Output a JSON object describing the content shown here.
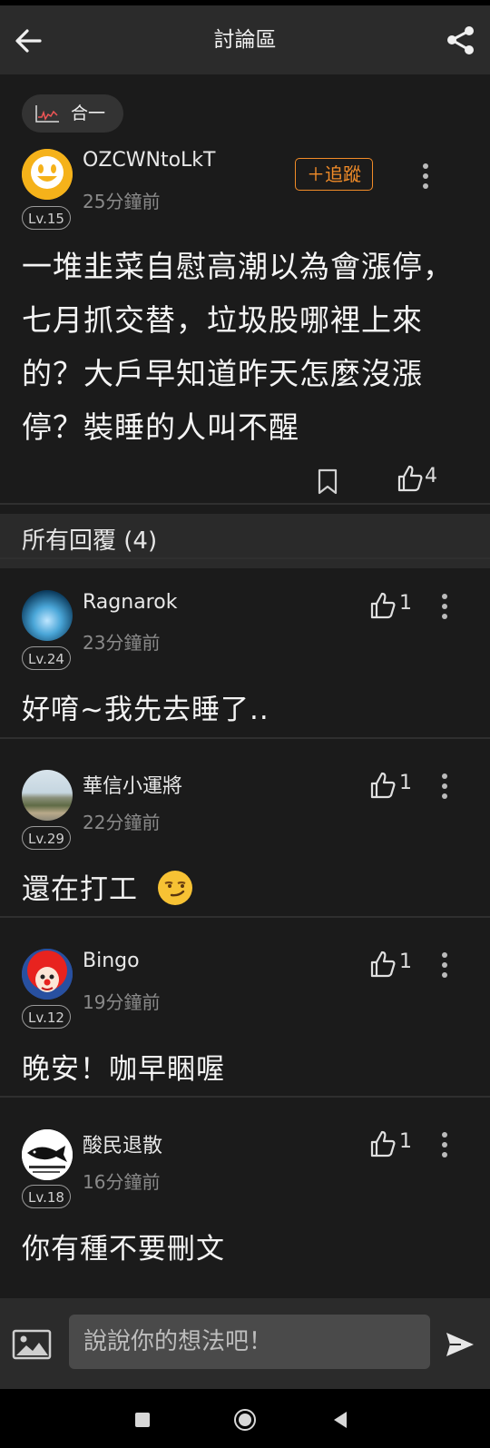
{
  "app": {
    "title": "討論區"
  },
  "post": {
    "tag": "合一",
    "author": "OZCWNtoLkT",
    "level": "Lv.15",
    "time": "25分鐘前",
    "follow_label": "＋追蹤",
    "text": "一堆韭菜自慰高潮以為會漲停，七月抓交替，垃圾股哪裡上來的？大戶早知道昨天怎麼沒漲停？裝睡的人叫不醒",
    "likes": "4"
  },
  "replies_header": "所有回覆 (4)",
  "replies": [
    {
      "user": "Ragnarok",
      "level": "Lv.24",
      "time": "23分鐘前",
      "likes": "1",
      "text": "好唷~我先去睡了.."
    },
    {
      "user": "華信小運將",
      "level": "Lv.29",
      "time": "22分鐘前",
      "likes": "1",
      "text": "還在打工"
    },
    {
      "user": "Bingo",
      "level": "Lv.12",
      "time": "19分鐘前",
      "likes": "1",
      "text": "晚安！咖早睏喔"
    },
    {
      "user": "酸民退散",
      "level": "Lv.18",
      "time": "16分鐘前",
      "likes": "1",
      "text": "你有種不要刪文"
    }
  ],
  "composer": {
    "placeholder": "說說你的想法吧！"
  },
  "colors": {
    "accent": "#f28c28",
    "bg": "#1b1b1b",
    "bar": "#2b2b2b"
  }
}
